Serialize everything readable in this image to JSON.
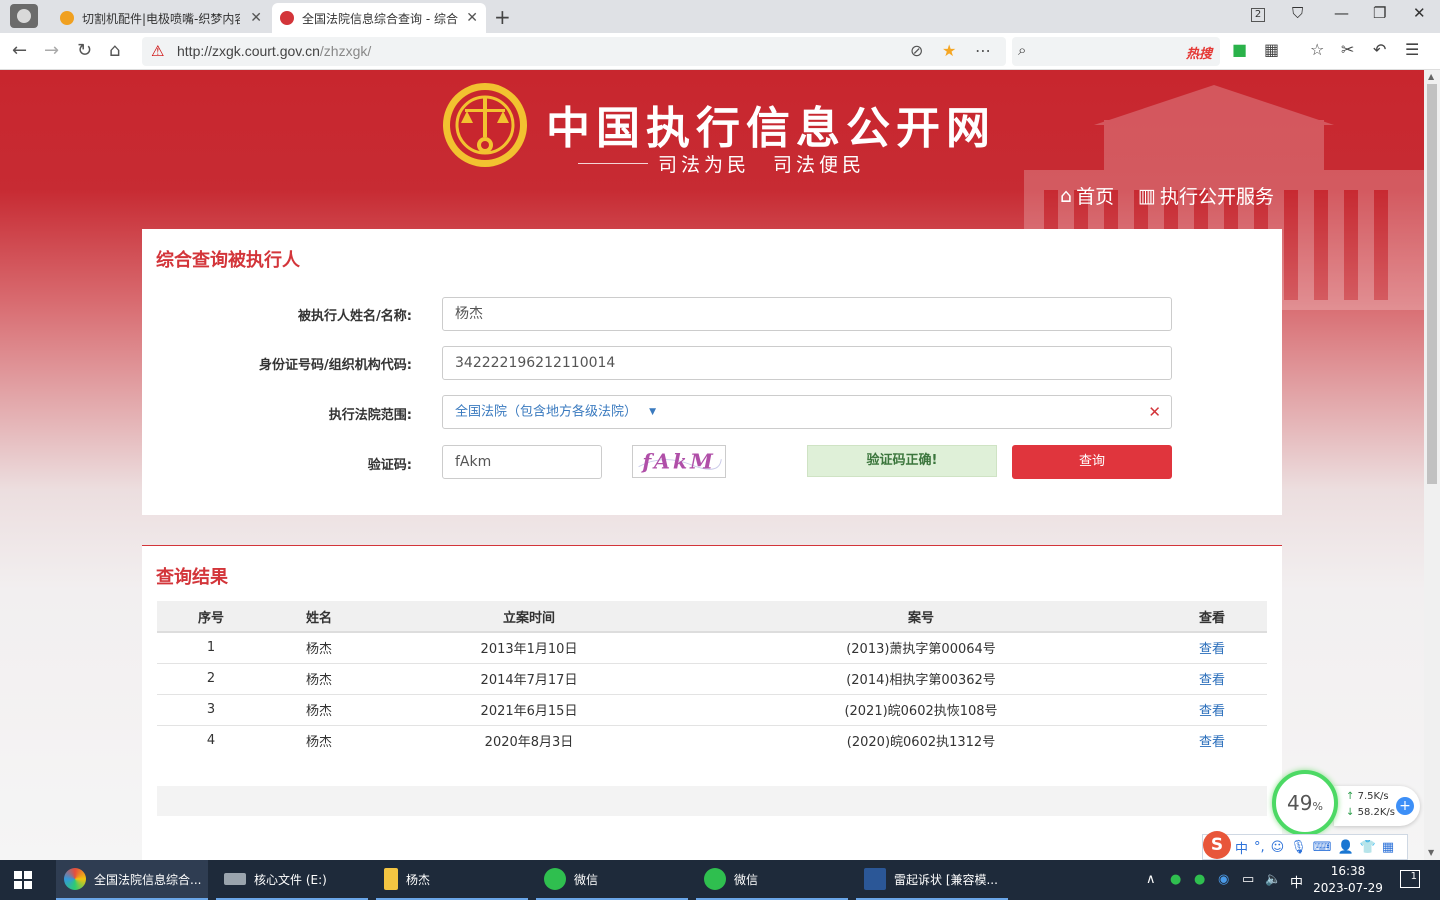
{
  "browser": {
    "tabs": [
      {
        "title": "切割机配件|电极喷嘴-织梦内容",
        "active": false,
        "favicon_color": "#f0a020"
      },
      {
        "title": "全国法院信息综合查询 - 综合",
        "active": true,
        "favicon_color": "#d3353a"
      }
    ],
    "tab_count_badge": "2",
    "url_host": "http://zxgk.court.gov.cn",
    "url_path": "/zhzxgk/",
    "search_hot_label": "热搜"
  },
  "site": {
    "title": "中国执行信息公开网",
    "slogan": "司法为民　司法便民",
    "nav": [
      {
        "label": "首页",
        "icon": "home-icon"
      },
      {
        "label": "执行公开服务",
        "icon": "chart-icon"
      }
    ]
  },
  "search_form": {
    "heading": "综合查询被执行人",
    "name_label": "被执行人姓名/名称:",
    "name_value": "杨杰",
    "id_label": "身份证号码/组织机构代码:",
    "id_value": "342222196212110014",
    "court_label": "执行法院范围:",
    "court_value": "全国法院（包含地方各级法院）",
    "captcha_label": "验证码:",
    "captcha_value": "fAkm",
    "captcha_image_text": "fAkM",
    "verify_status": "验证码正确!",
    "query_button": "查询"
  },
  "results": {
    "heading": "查询结果",
    "columns": [
      "序号",
      "姓名",
      "立案时间",
      "案号",
      "查看"
    ],
    "rows": [
      {
        "no": "1",
        "name": "杨杰",
        "date": "2013年1月10日",
        "case_no": "(2013)萧执字第00064号",
        "view": "查看"
      },
      {
        "no": "2",
        "name": "杨杰",
        "date": "2014年7月17日",
        "case_no": "(2014)相执字第00362号",
        "view": "查看"
      },
      {
        "no": "3",
        "name": "杨杰",
        "date": "2021年6月15日",
        "case_no": "(2021)皖0602执恢108号",
        "view": "查看"
      },
      {
        "no": "4",
        "name": "杨杰",
        "date": "2020年8月3日",
        "case_no": "(2020)皖0602执1312号",
        "view": "查看"
      }
    ]
  },
  "net_widget": {
    "percent": "49",
    "percent_unit": "%",
    "upload": "7.5K/s",
    "download": "58.2K/s"
  },
  "ime_toolbar": {
    "mode": "中"
  },
  "taskbar": {
    "items": [
      {
        "label": "全国法院信息综合...",
        "color": "#e74c3c"
      },
      {
        "label": "核心文件 (E:)",
        "color": "#9aa4ad"
      },
      {
        "label": "杨杰",
        "color": "#f4c542"
      },
      {
        "label": "微信",
        "color": "#2fbf4f"
      },
      {
        "label": "微信",
        "color": "#2fbf4f"
      },
      {
        "label": "雷起诉状 [兼容模...",
        "color": "#2b5797"
      }
    ],
    "ime_indicator": "中",
    "time": "16:38",
    "date": "2023-07-29",
    "notification_count": "1"
  }
}
